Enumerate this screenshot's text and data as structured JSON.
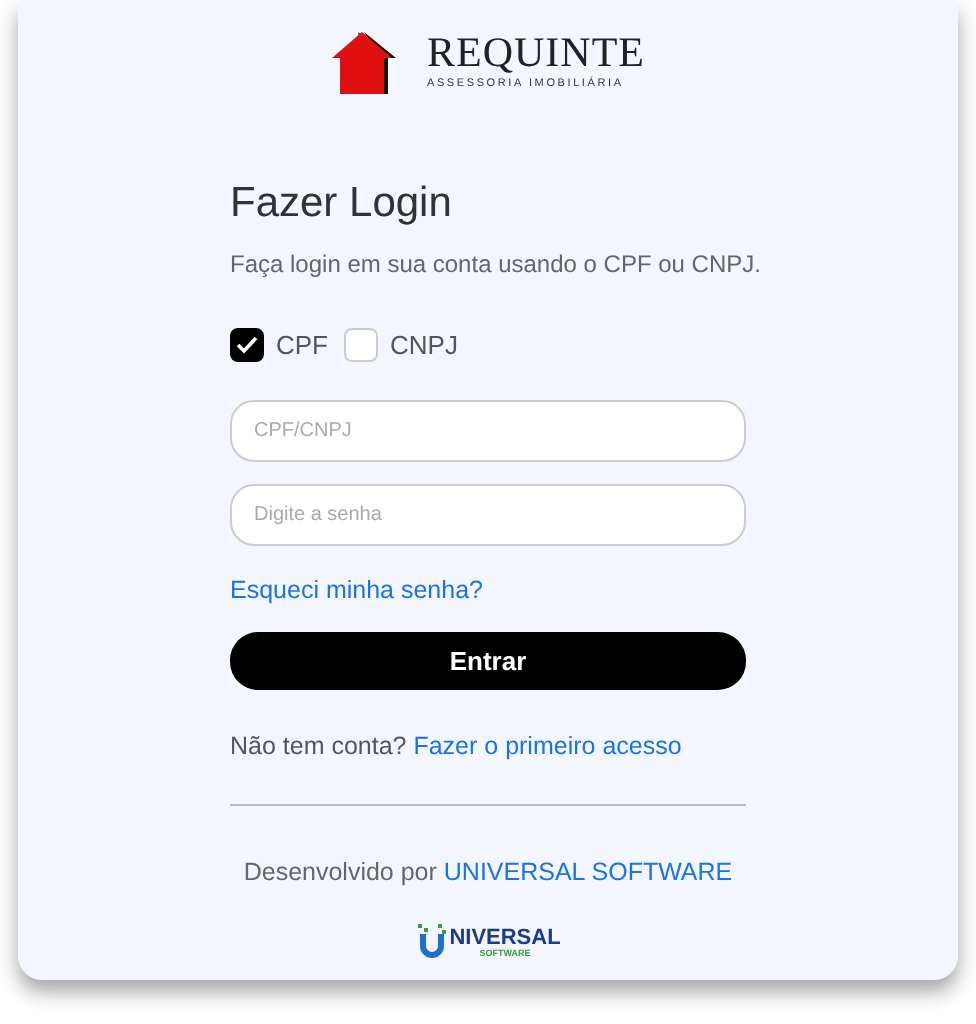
{
  "logo": {
    "name": "REQUINTE",
    "tagline": "ASSESSORIA IMOBILIÁRIA"
  },
  "title": "Fazer Login",
  "subtitle": "Faça login em sua conta usando o CPF ou CNPJ.",
  "doc_types": [
    {
      "label": "CPF",
      "checked": true
    },
    {
      "label": "CNPJ",
      "checked": false
    }
  ],
  "fields": [
    {
      "placeholder": "CPF/CNPJ"
    },
    {
      "placeholder": "Digite a senha"
    }
  ],
  "forgot_link": "Esqueci minha senha?",
  "submit_button": "Entrar",
  "signup": {
    "text": "Não tem conta?",
    "link": "Fazer o primeiro acesso"
  },
  "footer": {
    "text": "Desenvolvido por",
    "link": "UNIVERSAL SOFTWARE"
  },
  "developer_logo": {
    "name": "NIVERSAL",
    "tagline": "SOFTWARE"
  }
}
